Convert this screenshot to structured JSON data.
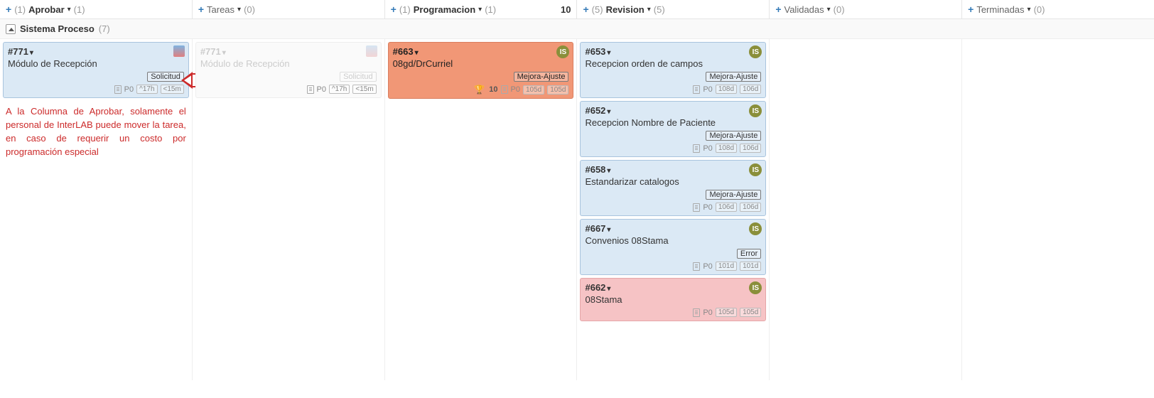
{
  "columns": [
    {
      "title": "Aprobar",
      "left_count": "(1)",
      "right_count": "(1)",
      "score": null,
      "dim": false
    },
    {
      "title": "Tareas",
      "left_count": null,
      "right_count": "(0)",
      "score": null,
      "dim": true
    },
    {
      "title": "Programacion",
      "left_count": "(1)",
      "right_count": "(1)",
      "score": "10",
      "dim": false
    },
    {
      "title": "Revision",
      "left_count": "(5)",
      "right_count": "(5)",
      "score": null,
      "dim": false
    },
    {
      "title": "Validadas",
      "left_count": null,
      "right_count": "(0)",
      "score": null,
      "dim": true
    },
    {
      "title": "Terminadas",
      "left_count": null,
      "right_count": "(0)",
      "score": null,
      "dim": true
    }
  ],
  "swimlane": {
    "title": "Sistema Proceso",
    "count": "(7)"
  },
  "cards": {
    "aprobar": {
      "c771": {
        "id": "#771",
        "title": "Módulo de Recepción",
        "tag": "Solicitud",
        "priority": "P0",
        "time1": "^17h",
        "time2": "<15m"
      }
    },
    "tareas_ghost": {
      "c771g": {
        "id": "#771",
        "title": "Módulo de Recepción",
        "tag": "Solicitud",
        "priority": "P0",
        "time1": "^17h",
        "time2": "<15m"
      }
    },
    "programacion": {
      "c663": {
        "id": "#663",
        "title": "08gd/DrCurriel",
        "tag": "Mejora-Ajuste",
        "badge": "IS",
        "score": "10",
        "priority": "P0",
        "time1": "105d",
        "time2": "105d"
      }
    },
    "revision": [
      {
        "id": "#653",
        "title": "Recepcion orden de campos",
        "tag": "Mejora-Ajuste",
        "badge": "IS",
        "priority": "P0",
        "time1": "108d",
        "time2": "106d",
        "variant": "blue"
      },
      {
        "id": "#652",
        "title": "Recepcion Nombre de Paciente",
        "tag": "Mejora-Ajuste",
        "badge": "IS",
        "priority": "P0",
        "time1": "108d",
        "time2": "106d",
        "variant": "blue"
      },
      {
        "id": "#658",
        "title": "Estandarizar catalogos",
        "tag": "Mejora-Ajuste",
        "badge": "IS",
        "priority": "P0",
        "time1": "106d",
        "time2": "106d",
        "variant": "blue"
      },
      {
        "id": "#667",
        "title": "Convenios 08Stama",
        "tag": "Error",
        "badge": "IS",
        "priority": "P0",
        "time1": "101d",
        "time2": "101d",
        "variant": "blue"
      },
      {
        "id": "#662",
        "title": "08Stama",
        "tag": null,
        "badge": "IS",
        "priority": "P0",
        "time1": "105d",
        "time2": "105d",
        "variant": "pink"
      }
    ]
  },
  "note": "A la Columna de Aprobar, solamente el personal de InterLAB puede mover la tarea, en caso de requerir un costo por programación especial"
}
